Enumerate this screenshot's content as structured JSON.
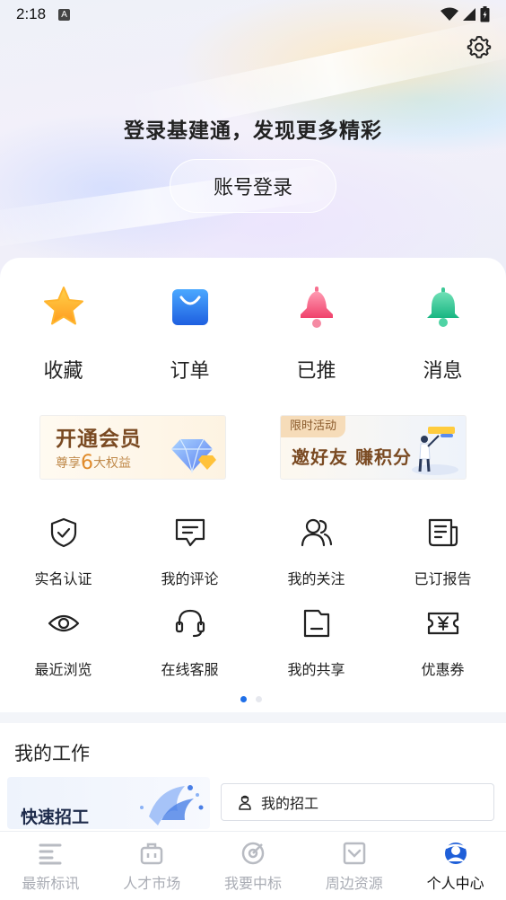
{
  "status_bar": {
    "time": "2:18",
    "indicator": "A"
  },
  "header": {
    "slogan": "登录基建通，发现更多精彩",
    "login_button": "账号登录"
  },
  "quick_actions": [
    {
      "label": "收藏",
      "icon": "star-icon"
    },
    {
      "label": "订单",
      "icon": "shopping-bag-icon"
    },
    {
      "label": "已推",
      "icon": "rocket-icon"
    },
    {
      "label": "消息",
      "icon": "bell-icon"
    }
  ],
  "banners": {
    "vip": {
      "title": "开通会员",
      "sub_prefix": "尊享",
      "sub_number": "6",
      "sub_suffix": "大权益"
    },
    "invite": {
      "tag": "限时活动",
      "title": "邀好友 赚积分"
    }
  },
  "services": {
    "row1": [
      {
        "label": "实名认证",
        "icon": "shield-check-icon"
      },
      {
        "label": "我的评论",
        "icon": "comment-icon"
      },
      {
        "label": "我的关注",
        "icon": "users-icon"
      },
      {
        "label": "已订报告",
        "icon": "report-icon"
      }
    ],
    "row2": [
      {
        "label": "最近浏览",
        "icon": "eye-icon"
      },
      {
        "label": "在线客服",
        "icon": "headset-icon"
      },
      {
        "label": "我的共享",
        "icon": "folder-icon"
      },
      {
        "label": "优惠券",
        "icon": "coupon-icon"
      }
    ]
  },
  "pager": {
    "count": 2,
    "active": 0
  },
  "work": {
    "title": "我的工作",
    "quick_card": "快速招工",
    "recruit": "我的招工"
  },
  "tabs": [
    {
      "label": "最新标讯",
      "icon": "list-icon",
      "active": false
    },
    {
      "label": "人才市场",
      "icon": "briefcase-icon",
      "active": false
    },
    {
      "label": "我要中标",
      "icon": "target-icon",
      "active": false
    },
    {
      "label": "周边资源",
      "icon": "inbox-icon",
      "active": false
    },
    {
      "label": "个人中心",
      "icon": "profile-icon",
      "active": true
    }
  ],
  "colors": {
    "accent": "#1f6fe8",
    "gold": "#7a4a22",
    "text": "#222222",
    "muted": "#a9acb4"
  }
}
